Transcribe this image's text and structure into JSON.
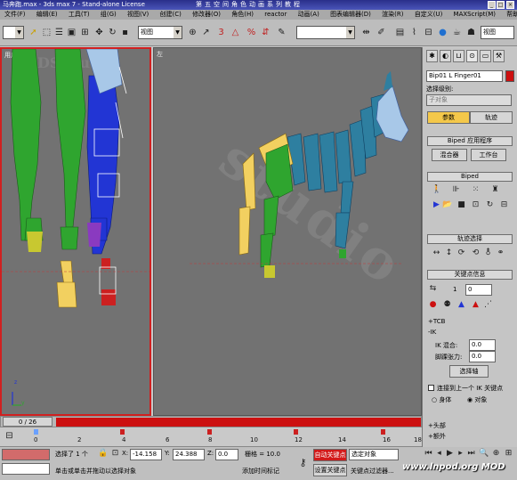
{
  "window": {
    "title": "马奔跑.max - 3ds max 7 - Stand-alone License",
    "banner": "第五空间角色动画系列教程"
  },
  "menu": [
    "文件(F)",
    "编辑(E)",
    "工具(T)",
    "组(G)",
    "视图(V)",
    "创建(C)",
    "修改器(O)",
    "角色(H)",
    "reactor",
    "动画(A)",
    "图表编辑器(D)",
    "渲染(R)",
    "自定义(U)",
    "MAXScript(M)",
    "帮助(H)"
  ],
  "toolbar": {
    "view_combo": "视图",
    "selection_set": "",
    "view_combo2": "视图"
  },
  "viewports": {
    "left_label": "用户",
    "right_label": "左",
    "watermark_left": "DS studio",
    "watermark_right": "studio",
    "axis_x": "x",
    "axis_y": "y",
    "axis_z": "z"
  },
  "timeline": {
    "frame_counter": "0 / 26",
    "ticks": [
      "0",
      "2",
      "4",
      "6",
      "8",
      "10",
      "12",
      "14",
      "16",
      "18"
    ]
  },
  "status": {
    "selected": "选择了 1 个",
    "x_label": "X:",
    "x_value": "-14.158",
    "y_label": "Y:",
    "y_value": "24.388",
    "z_label": "Z:",
    "z_value": "0.0",
    "grid": "栅格 = 10.0",
    "prompt": "单击或单击并拖动以选择对象",
    "add_tag": "添加时间标记",
    "auto_key": "自动关键点",
    "set_key": "设置关键点",
    "selected_obj": "选定对象",
    "key_filter": "关键点过滤器...",
    "logo": "www.lnpod.org MOD"
  },
  "panel": {
    "object_name": "Bip01 L Finger01",
    "selection_set_label": "选择级别:",
    "sub_object": "子对象",
    "tab_params": "参数",
    "tab_motion": "轨迹",
    "rollout_apps": "Biped 应用程序",
    "mixer": "混合器",
    "workbench": "工作台",
    "rollout_biped": "Biped",
    "rollout_track": "轨迹选择",
    "rollout_key": "关键点信息",
    "key_field": "1",
    "key_value": "0",
    "tcb": "+TCB",
    "ik": "-IK",
    "ik_blend_label": "IK 混合:",
    "ik_blend_value": "0.0",
    "ankle_label": "脚踝张力:",
    "ankle_value": "0.0",
    "select_pivot": "选择轴",
    "join_prev": "连接到上一个 IK 关键点",
    "body_label": "身体",
    "object_label": "对象",
    "head": "+头部",
    "extra": "+额外"
  },
  "colors": {
    "green": "#2fa52f",
    "blue": "#2235d4",
    "yellow": "#f2d060",
    "teal": "#2e7fa0",
    "red": "#cc1010"
  }
}
